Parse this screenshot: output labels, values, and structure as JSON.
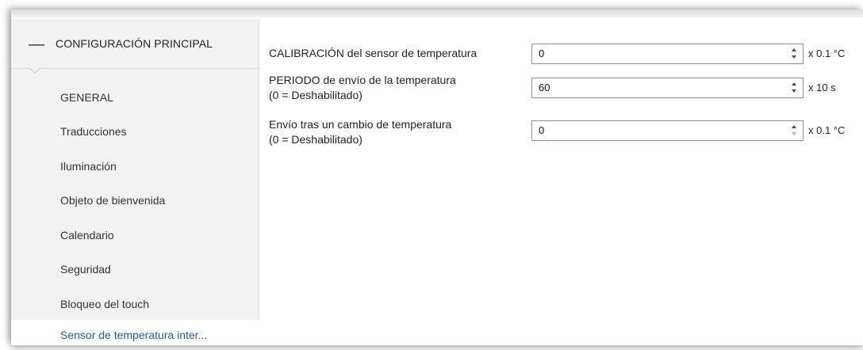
{
  "sidebar": {
    "header": {
      "icon": "minus-icon",
      "symbol": "—",
      "title": "CONFIGURACIÓN PRINCIPAL"
    },
    "items": [
      {
        "label": "GENERAL"
      },
      {
        "label": "Traducciones"
      },
      {
        "label": "Iluminación"
      },
      {
        "label": "Objeto de bienvenida"
      },
      {
        "label": "Calendario"
      },
      {
        "label": "Seguridad"
      },
      {
        "label": "Bloqueo del touch"
      },
      {
        "label": "Sensor de temperatura inter..."
      }
    ],
    "active_item": "Sensor de temperatura inter...",
    "active_color": "#1f5fa8"
  },
  "params": [
    {
      "label_line1": "CALIBRACIÓN del sensor de temperatura",
      "label_line2": "",
      "value": "0",
      "unit": "x 0.1 °C"
    },
    {
      "label_line1": "PERIODO de envío de la temperatura",
      "label_line2": "(0 = Deshabilitado)",
      "value": "60",
      "unit": "x 10 s"
    },
    {
      "label_line1": "Envío tras un cambio de temperatura",
      "label_line2": "(0 = Deshabilitado)",
      "value": "0",
      "unit": "x 0.1 °C"
    }
  ]
}
